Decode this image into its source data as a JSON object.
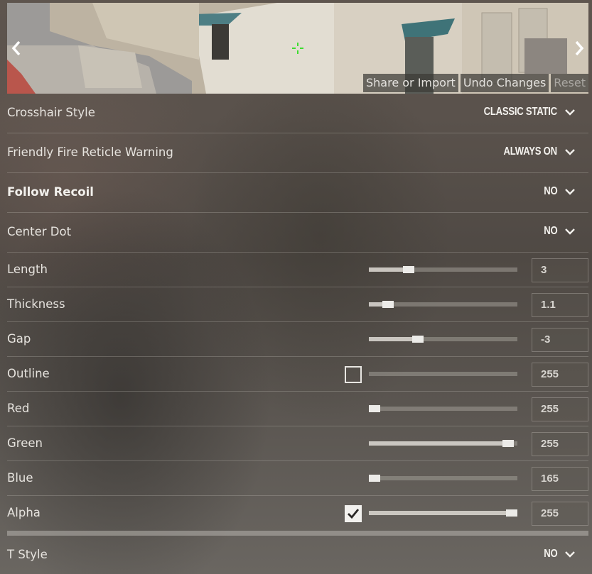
{
  "preview": {
    "buttons": [
      "Share or Import",
      "Undo Changes",
      "Reset"
    ],
    "icons": {
      "prev": "chevron-left-icon",
      "next": "chevron-right-icon",
      "crosshair": "crosshair-preview-icon"
    },
    "crosshair_color": "#3ddc2f"
  },
  "settings": {
    "crosshair_style": {
      "label": "Crosshair Style",
      "value": "CLASSIC STATIC"
    },
    "friendly_fire": {
      "label": "Friendly Fire Reticle Warning",
      "value": "ALWAYS ON"
    },
    "follow_recoil": {
      "label": "Follow Recoil",
      "value": "NO"
    },
    "center_dot": {
      "label": "Center Dot",
      "value": "NO"
    },
    "length": {
      "label": "Length",
      "value": "3",
      "level": 0.27
    },
    "thickness": {
      "label": "Thickness",
      "value": "1.1",
      "level": 0.13
    },
    "gap": {
      "label": "Gap",
      "value": "-3",
      "level": 0.33
    },
    "outline": {
      "label": "Outline",
      "value": "255",
      "level": 0.0,
      "checked": false
    },
    "red": {
      "label": "Red",
      "value": "255",
      "level": 0.04
    },
    "green": {
      "label": "Green",
      "value": "255",
      "level": 0.94
    },
    "blue": {
      "label": "Blue",
      "value": "165",
      "level": 0.04
    },
    "alpha": {
      "label": "Alpha",
      "value": "255",
      "level": 0.96,
      "checked": true
    },
    "t_style": {
      "label": "T Style",
      "value": "NO"
    }
  }
}
